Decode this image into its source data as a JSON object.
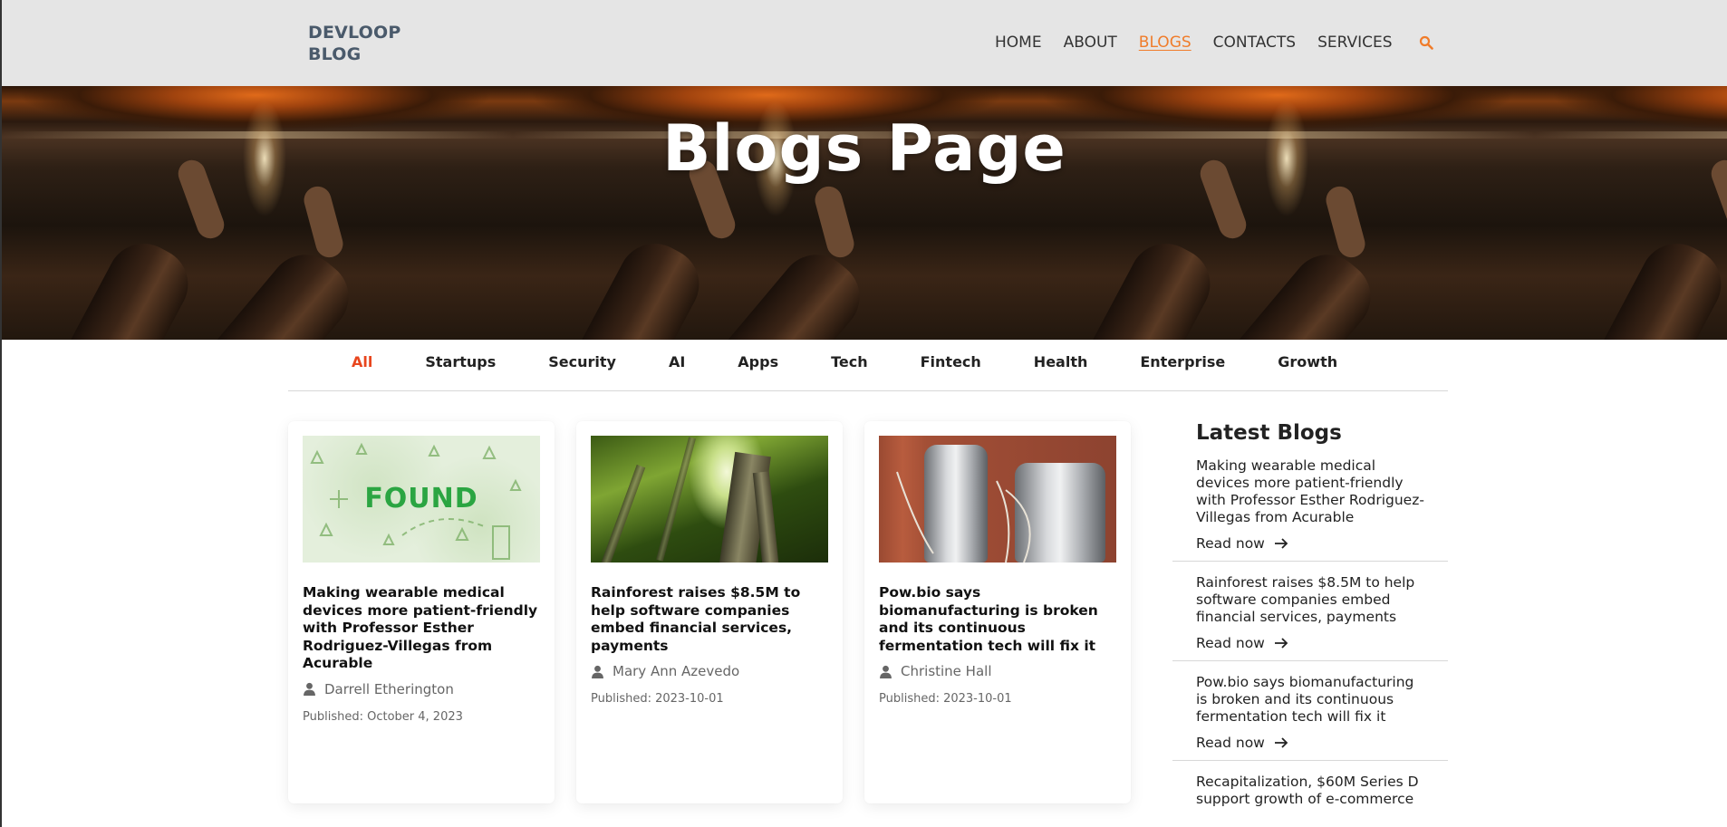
{
  "header": {
    "logo_line1": "DEVLOOP",
    "logo_line2": "BLOG",
    "nav": [
      "HOME",
      "ABOUT",
      "BLOGS",
      "CONTACTS",
      "SERVICES"
    ],
    "active_nav": "BLOGS",
    "accent_color": "#f07c2a"
  },
  "hero": {
    "title": "Blogs Page"
  },
  "categories": {
    "items": [
      "All",
      "Startups",
      "Security",
      "AI",
      "Apps",
      "Tech",
      "Fintech",
      "Health",
      "Enterprise",
      "Growth"
    ],
    "active": "All",
    "active_color": "#e8461e"
  },
  "cards": [
    {
      "image_text": "FOUND",
      "title": "Making wearable medical devices more patient-friendly with Professor Esther Rodriguez-Villegas from Acurable",
      "author": "Darrell Etherington",
      "published": "Published: October 4, 2023"
    },
    {
      "title": "Rainforest raises $8.5M to help software companies embed financial services, payments",
      "author": "Mary Ann Azevedo",
      "published": "Published: 2023-10-01"
    },
    {
      "title": "Pow.bio says biomanufacturing is broken and its continuous fermentation tech will fix it",
      "author": "Christine Hall",
      "published": "Published: 2023-10-01"
    }
  ],
  "sidebar": {
    "heading": "Latest Blogs",
    "read_label": "Read now",
    "items": [
      "Making wearable medical devices more patient-friendly with Professor Esther Rodriguez-Villegas from Acurable",
      "Rainforest raises $8.5M to help software companies embed financial services, payments",
      "Pow.bio says biomanufacturing is broken and its continuous fermentation tech will fix it",
      "Recapitalization, $60M Series D support growth of e-commerce"
    ]
  }
}
